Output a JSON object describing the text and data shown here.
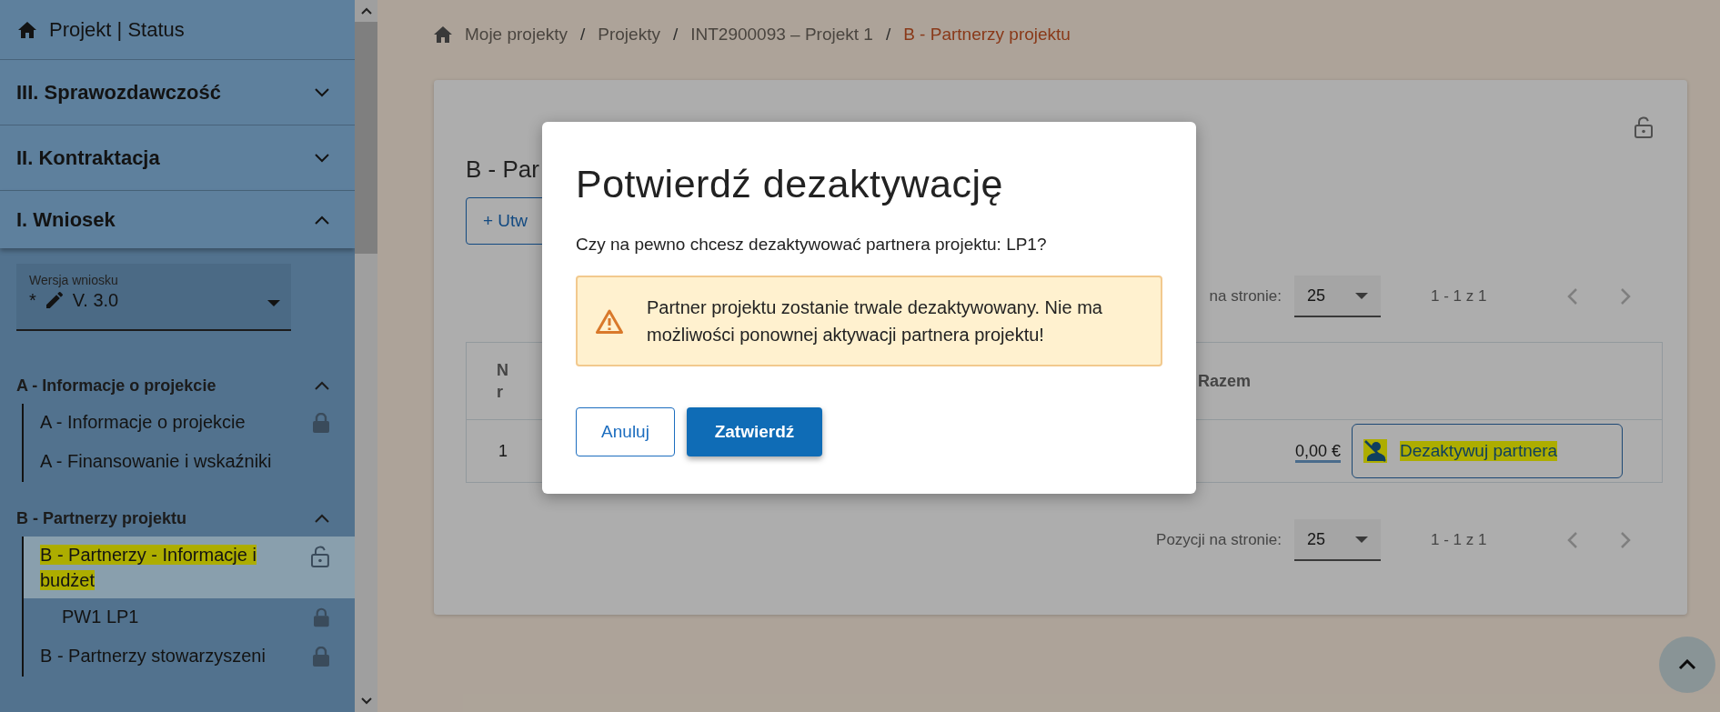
{
  "sidebar": {
    "header": {
      "label": "Projekt | Status"
    },
    "sections": [
      {
        "label": "III. Sprawozdawczość",
        "expanded": false
      },
      {
        "label": "II. Kontraktacja",
        "expanded": false
      },
      {
        "label": "I. Wniosek",
        "expanded": true
      }
    ],
    "version_select": {
      "label": "Wersja wniosku",
      "prefix": "*",
      "value": "V. 3.0"
    },
    "groups": [
      {
        "label": "A - Informacje o projekcie",
        "expanded": true,
        "children": [
          {
            "label": "A - Informacje o projekcie",
            "locked": true,
            "selected": false,
            "highlighted": false
          },
          {
            "label": "A - Finansowanie i wskaźniki",
            "selected": false,
            "highlighted": false
          }
        ]
      },
      {
        "label": "B - Partnerzy projektu",
        "expanded": true,
        "children": [
          {
            "label": "B - Partnerzy - Informacje i budżet",
            "locked": false,
            "selected": true,
            "highlighted": true,
            "children": [
              {
                "label": "PW1 LP1",
                "locked": true,
                "selected": false,
                "highlighted": false
              }
            ]
          },
          {
            "label": "B - Partnerzy stowarzyszeni",
            "locked": true,
            "selected": false,
            "highlighted": false
          }
        ]
      }
    ]
  },
  "main": {
    "breadcrumb": [
      {
        "kind": "link",
        "label": "Moje projekty",
        "current": false
      },
      {
        "kind": "separator",
        "label": "/"
      },
      {
        "kind": "link",
        "label": "Projekty",
        "current": false
      },
      {
        "kind": "separator",
        "label": "/"
      },
      {
        "kind": "link",
        "label": "INT2900093 – Projekt 1",
        "current": false
      },
      {
        "kind": "separator",
        "label": "/"
      },
      {
        "kind": "link",
        "label": "B - Partnerzy projektu",
        "current": true
      }
    ],
    "card": {
      "locked": false,
      "title": "B - Par",
      "create_button": "+ Utw",
      "pagination_top": {
        "label": "na stronie:",
        "page_size": "25",
        "range": "1 - 1 z 1"
      },
      "table": {
        "columns": [
          {
            "label": "Nr"
          },
          {
            "label": "Razem"
          }
        ],
        "rows": [
          {
            "nr": "1",
            "razem": "0,00 €",
            "action": {
              "label": "Dezaktywuj partnera",
              "highlighted": true
            }
          }
        ]
      },
      "pagination_bottom": {
        "label": "Pozycji na stronie:",
        "page_size": "25",
        "range": "1 - 1 z 1"
      }
    }
  },
  "dialog": {
    "title": "Potwierdź dezaktywację",
    "message": "Czy na pewno chcesz dezaktywować partnera projektu: LP1?",
    "warning": "Partner projektu zostanie trwale dezaktywowany. Nie ma możliwości ponownej aktywacji partnera projektu!",
    "buttons": [
      {
        "label": "Anuluj",
        "kind": "secondary"
      },
      {
        "label": "Zatwierdź",
        "kind": "primary"
      }
    ]
  }
}
